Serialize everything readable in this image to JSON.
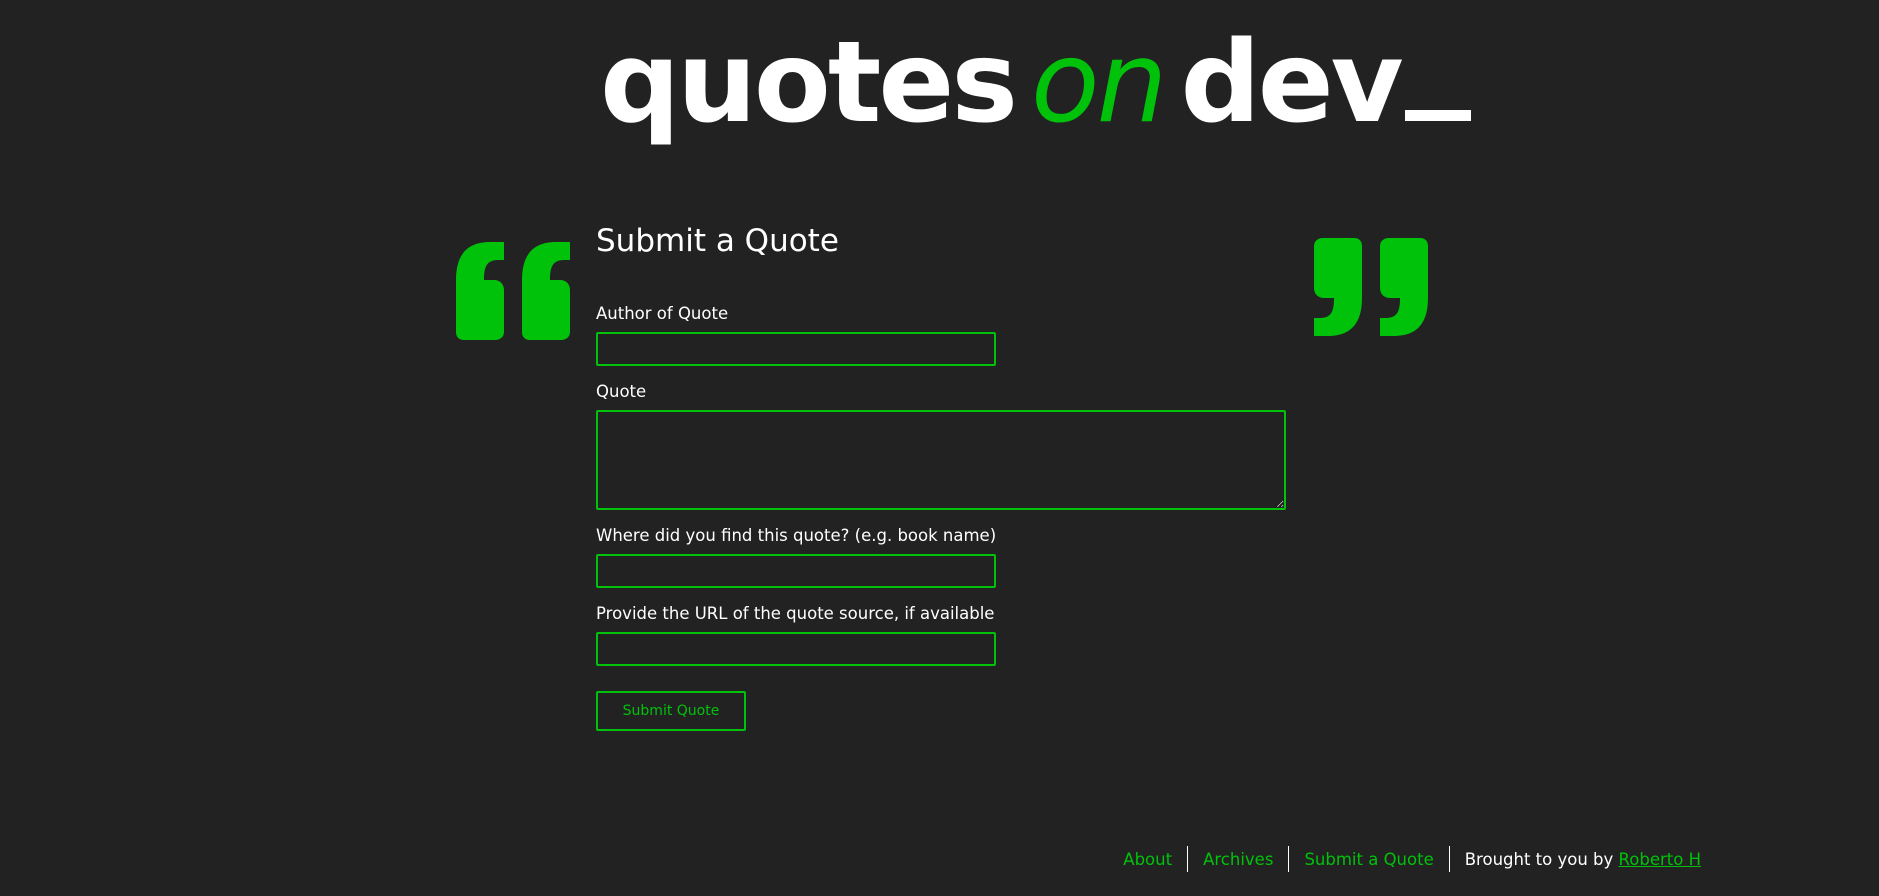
{
  "header": {
    "logo_word_1": "quotes",
    "logo_word_2": "on",
    "logo_word_3": "dev"
  },
  "form": {
    "title": "Submit a Quote",
    "author_label": "Author of Quote",
    "author_value": "",
    "quote_label": "Quote",
    "quote_value": "",
    "source_label": "Where did you find this quote? (e.g. book name)",
    "source_value": "",
    "url_label": "Provide the URL of the quote source, if available",
    "url_value": "",
    "submit_label": "Submit Quote"
  },
  "footer": {
    "links": {
      "about": "About",
      "archives": "Archives",
      "submit": "Submit a Quote"
    },
    "credit_prefix": "Brought to you by",
    "credit_name": "Roberto H"
  },
  "colors": {
    "background": "#222222",
    "accent": "#00c20a",
    "text": "#ffffff"
  },
  "icons": {
    "open_quote": "open-quote-icon",
    "close_quote": "close-quote-icon",
    "resize": "resize-handle-icon"
  }
}
